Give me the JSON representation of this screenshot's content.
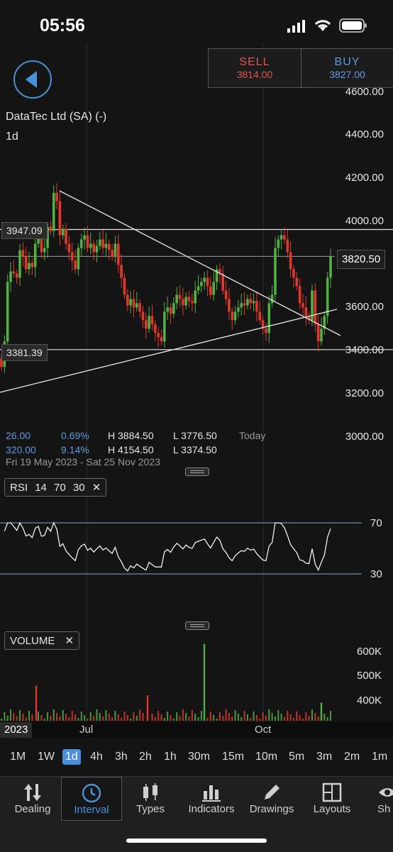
{
  "status_bar": {
    "time": "05:56"
  },
  "trade": {
    "sell_label": "SELL",
    "sell_price": "3814.00",
    "buy_label": "BUY",
    "buy_price": "3827.00"
  },
  "instrument": {
    "name": "DataTec Ltd (SA) (-)",
    "interval": "1d"
  },
  "price_axis": [
    "4600.00",
    "4400.00",
    "4200.00",
    "4000.00",
    "3600.00",
    "3400.00",
    "3200.00",
    "3000.00"
  ],
  "price_levels": {
    "resistance": "3947.09",
    "support": "3381.39",
    "current": "3820.50"
  },
  "stats": {
    "row1": {
      "change": "26.00",
      "pct": "0.69%",
      "high": "H 3884.50",
      "low": "L 3776.50",
      "period": "Today"
    },
    "row2": {
      "change": "320.00",
      "pct": "9.14%",
      "high": "H 4154.50",
      "low": "L 3374.50"
    },
    "range": "Fri 19 May 2023 - Sat 25 Nov 2023"
  },
  "rsi": {
    "label": "RSI",
    "period": "14",
    "upper": "70",
    "lower": "30",
    "axis_upper": "70",
    "axis_lower": "30"
  },
  "volume": {
    "label": "VOLUME",
    "axis": [
      "600K",
      "500K",
      "400K"
    ]
  },
  "time_axis": {
    "year": "2023",
    "jul": "Jul",
    "oct": "Oct"
  },
  "intervals": [
    "1M",
    "1W",
    "1d",
    "4h",
    "3h",
    "2h",
    "1h",
    "30m",
    "15m",
    "10m",
    "5m",
    "3m",
    "2m",
    "1m"
  ],
  "active_interval": "1d",
  "nav": [
    {
      "label": "Dealing",
      "icon": "dealing-arrows-icon"
    },
    {
      "label": "Interval",
      "icon": "clock-icon"
    },
    {
      "label": "Types",
      "icon": "candlestick-icon"
    },
    {
      "label": "Indicators",
      "icon": "bar-chart-icon"
    },
    {
      "label": "Drawings",
      "icon": "pencil-icon"
    },
    {
      "label": "Layouts",
      "icon": "layout-grid-icon"
    },
    {
      "label": "Sh",
      "icon": "eye-icon"
    }
  ],
  "colors": {
    "up": "#52b043",
    "down": "#e0392b",
    "accent": "#4a90d9",
    "sell": "#e0564c",
    "buy": "#5b9be0"
  },
  "chart_data": {
    "type": "candlestick",
    "title": "DataTec Ltd (SA) (-)",
    "ylim": [
      3000,
      4600
    ],
    "close_series": [
      3300,
      3420,
      3700,
      3750,
      3740,
      3720,
      3850,
      3820,
      3760,
      3790,
      3770,
      3880,
      3920,
      3840,
      3860,
      3960,
      3940,
      4120,
      4080,
      3920,
      3950,
      3880,
      3840,
      3800,
      3760,
      3860,
      3900,
      3920,
      3860,
      3880,
      3840,
      3870,
      3900,
      3860,
      3880,
      3850,
      3820,
      3880,
      3780,
      3720,
      3640,
      3590,
      3620,
      3580,
      3600,
      3560,
      3520,
      3480,
      3540,
      3500,
      3460,
      3440,
      3420,
      3560,
      3580,
      3550,
      3600,
      3640,
      3620,
      3590,
      3630,
      3610,
      3600,
      3660,
      3680,
      3700,
      3720,
      3680,
      3640,
      3700,
      3760,
      3740,
      3660,
      3620,
      3560,
      3520,
      3560,
      3580,
      3600,
      3590,
      3620,
      3600,
      3610,
      3560,
      3520,
      3480,
      3460,
      3600,
      3640,
      3860,
      3900,
      3920,
      3900,
      3840,
      3760,
      3720,
      3680,
      3600,
      3580,
      3540,
      3520,
      3660,
      3500,
      3420,
      3480,
      3540,
      3720,
      3820
    ],
    "volume_highlights": [
      {
        "label": "spike",
        "value": 630000,
        "direction": "up"
      },
      {
        "label": "early-down",
        "value": 460000,
        "direction": "down"
      },
      {
        "label": "mid-down",
        "value": 420000,
        "direction": "down"
      },
      {
        "label": "late-up",
        "value": 390000,
        "direction": "up"
      }
    ],
    "rsi_range": [
      30,
      70
    ]
  }
}
